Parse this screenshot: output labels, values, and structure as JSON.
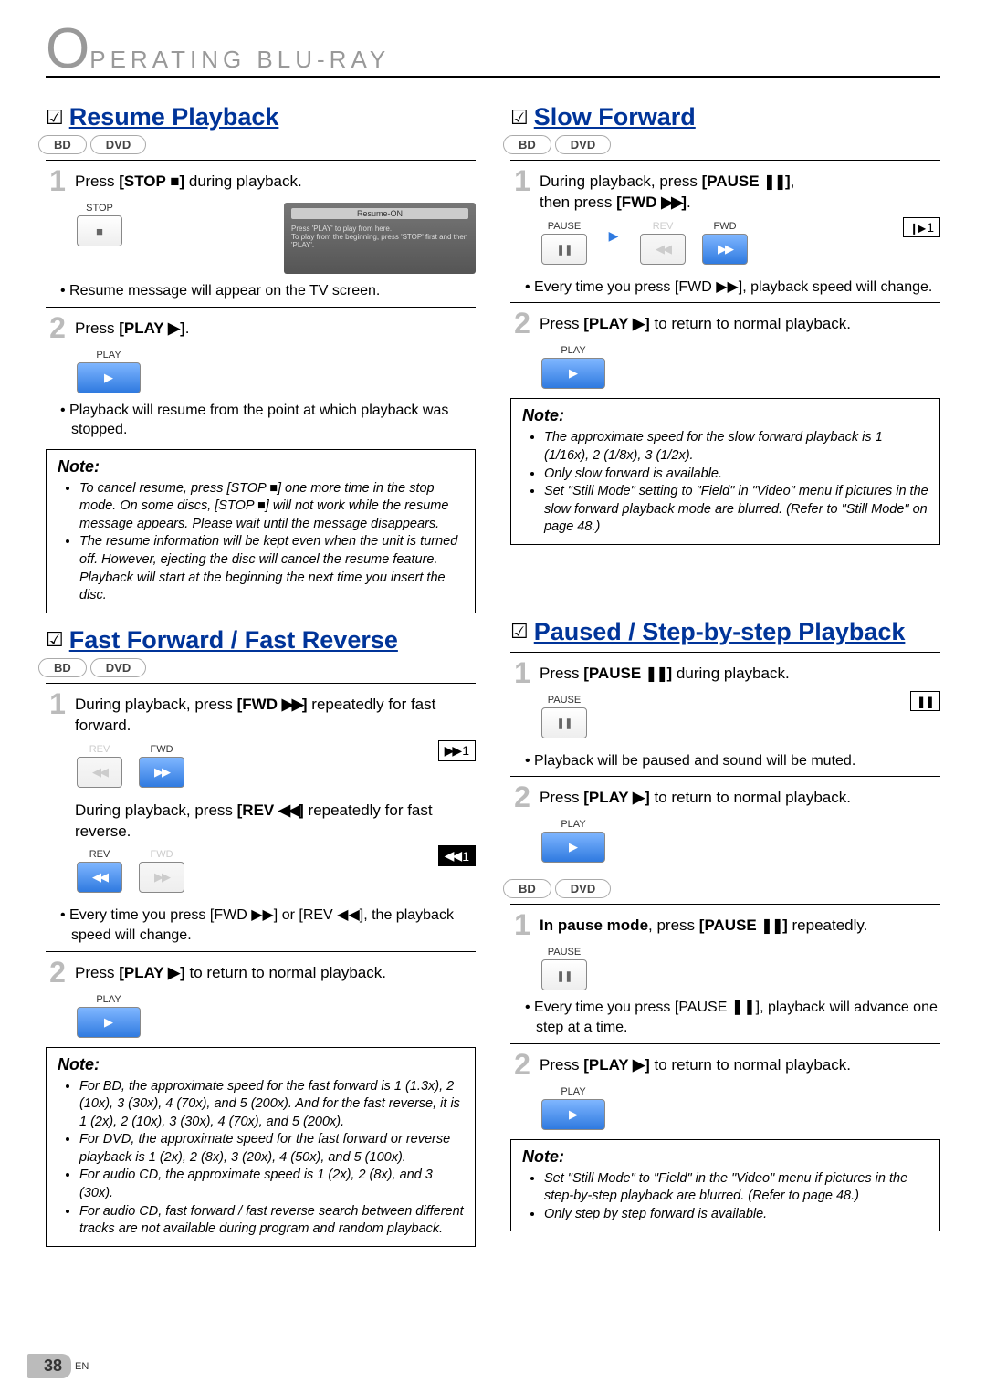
{
  "header": {
    "big_letter": "O",
    "rest": "PERATING  BLU-RAY"
  },
  "badges": {
    "bd": "BD",
    "dvd": "DVD"
  },
  "buttons": {
    "stop": "STOP",
    "play": "PLAY",
    "pause": "PAUSE",
    "rev": "REV",
    "fwd": "FWD"
  },
  "osd": {
    "title": "Resume-ON",
    "line1": "Press 'PLAY' to play from here.",
    "line2": "To play from the beginning, press 'STOP' first and then 'PLAY'."
  },
  "resume": {
    "title": "Resume Playback",
    "s1_pre": "Press ",
    "s1_btn": "[STOP ",
    "s1_post": " during playback.",
    "b1": "•   Resume message will appear on the TV screen.",
    "s2_pre": "Press ",
    "s2_btn": "[PLAY ",
    "s2_post": ".",
    "b2": "•   Playback will resume from the point at which playback was stopped.",
    "note_head": "Note:",
    "note_items": [
      "To cancel resume, press [STOP ■] one more time in the stop mode. On some discs, [STOP ■] will not work while the resume message appears. Please wait until the message disappears.",
      "The resume information will be kept even when the unit is turned off. However, ejecting the disc will cancel the resume feature. Playback will start at the beginning the next time you insert the disc."
    ]
  },
  "ffrv": {
    "title": "Fast Forward / Fast Reverse",
    "s1a_pre": "During playback, press ",
    "s1a_btn": "[FWD ",
    "s1a_post": " repeatedly for fast forward.",
    "s1b_pre": "During playback, press ",
    "s1b_btn": "[REV ",
    "s1b_post": "  repeatedly for fast reverse.",
    "ind_ff": "1",
    "ind_rw": "1",
    "b1": "• Every time you press [FWD ▶▶] or [REV ◀◀], the playback speed will change.",
    "s2_pre": "Press ",
    "s2_btn": "[PLAY ",
    "s2_post": " to return to normal playback.",
    "note_head": "Note:",
    "note_items": [
      "For BD, the approximate speed for the fast forward is 1 (1.3x), 2 (10x), 3 (30x), 4 (70x), and 5 (200x). And for the fast reverse, it is 1 (2x), 2 (10x), 3 (30x), 4 (70x), and 5 (200x).",
      "For DVD, the approximate speed for the fast forward or reverse playback is 1 (2x), 2 (8x), 3 (20x), 4 (50x), and 5 (100x).",
      "For audio CD, the approximate speed is 1 (2x), 2 (8x), and 3 (30x).",
      "For audio CD, fast forward / fast reverse search between different tracks are not available during program and random playback."
    ]
  },
  "slow": {
    "title": "Slow Forward",
    "s1a_pre": "During playback, press ",
    "s1a_btn": "[PAUSE ",
    "s1a_mid": ",",
    "s1b_pre": "then press ",
    "s1b_btn": "[FWD ",
    "s1b_post": ".",
    "ind": "1",
    "b1": "• Every time you press [FWD ▶▶], playback speed will change.",
    "s2_pre": "Press ",
    "s2_btn": "[PLAY ",
    "s2_post": " to return to normal playback.",
    "note_head": "Note:",
    "note_items": [
      "The approximate speed for the slow forward playback is 1 (1/16x), 2 (1/8x), 3 (1/2x).",
      "Only slow forward is available.",
      "Set \"Still Mode\" setting to \"Field\" in \"Video\" menu if pictures in the slow forward playback mode are blurred. (Refer to \"Still Mode\" on page 48.)"
    ]
  },
  "paused": {
    "title": "Paused / Step-by-step Playback",
    "s1_pre": "Press ",
    "s1_btn": "[PAUSE ",
    "s1_post": " during playback.",
    "b1": "•   Playback will be paused and sound will be muted.",
    "s2_pre": "Press ",
    "s2_btn": "[PLAY ",
    "s2_post": " to return to normal playback.",
    "s1b_pre": "In pause mode",
    "s1b_mid": ", press ",
    "s1b_btn": "[PAUSE ",
    "s1b_post": " repeatedly.",
    "b2": "• Every time you press [PAUSE ❚❚], playback will advance one step at a time.",
    "s2b_pre": "Press ",
    "s2b_btn": "[PLAY ",
    "s2b_post": " to return to normal playback.",
    "note_head": "Note:",
    "note_items": [
      "Set \"Still Mode\" to \"Field\" in the \"Video\" menu if pictures in the step-by-step playback are blurred. (Refer to page 48.)",
      "Only step by step forward is available."
    ]
  },
  "pagenum": {
    "num": "38",
    "lang": "EN"
  }
}
